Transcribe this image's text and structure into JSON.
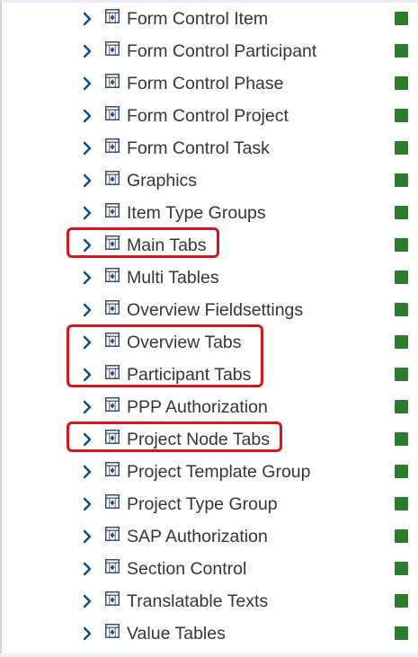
{
  "tree": {
    "items": [
      {
        "label": "Form Control Item"
      },
      {
        "label": "Form Control Participant"
      },
      {
        "label": "Form Control Phase"
      },
      {
        "label": "Form Control Project"
      },
      {
        "label": "Form Control Task"
      },
      {
        "label": "Graphics"
      },
      {
        "label": "Item Type Groups"
      },
      {
        "label": "Main Tabs"
      },
      {
        "label": "Multi Tables"
      },
      {
        "label": "Overview Fieldsettings"
      },
      {
        "label": "Overview Tabs"
      },
      {
        "label": "Participant Tabs"
      },
      {
        "label": "PPP Authorization"
      },
      {
        "label": "Project Node Tabs"
      },
      {
        "label": "Project Template Group"
      },
      {
        "label": "Project Type Group"
      },
      {
        "label": "SAP Authorization"
      },
      {
        "label": "Section Control"
      },
      {
        "label": "Translatable Texts"
      },
      {
        "label": "Value Tables"
      }
    ],
    "highlighted_groups": [
      [
        "Main Tabs"
      ],
      [
        "Overview Tabs",
        "Participant Tabs"
      ],
      [
        "Project Node Tabs"
      ]
    ]
  },
  "icons": {
    "expander": "chevron-right-icon",
    "object": "table-object-icon",
    "status": "status-square-icon"
  },
  "colors": {
    "text": "#32363a",
    "expander": "#0a4b85",
    "icon_border": "#3b4f6b",
    "icon_center": "#1f4f8f",
    "status_green": "#2b7d2b",
    "highlight": "#d7141c"
  }
}
